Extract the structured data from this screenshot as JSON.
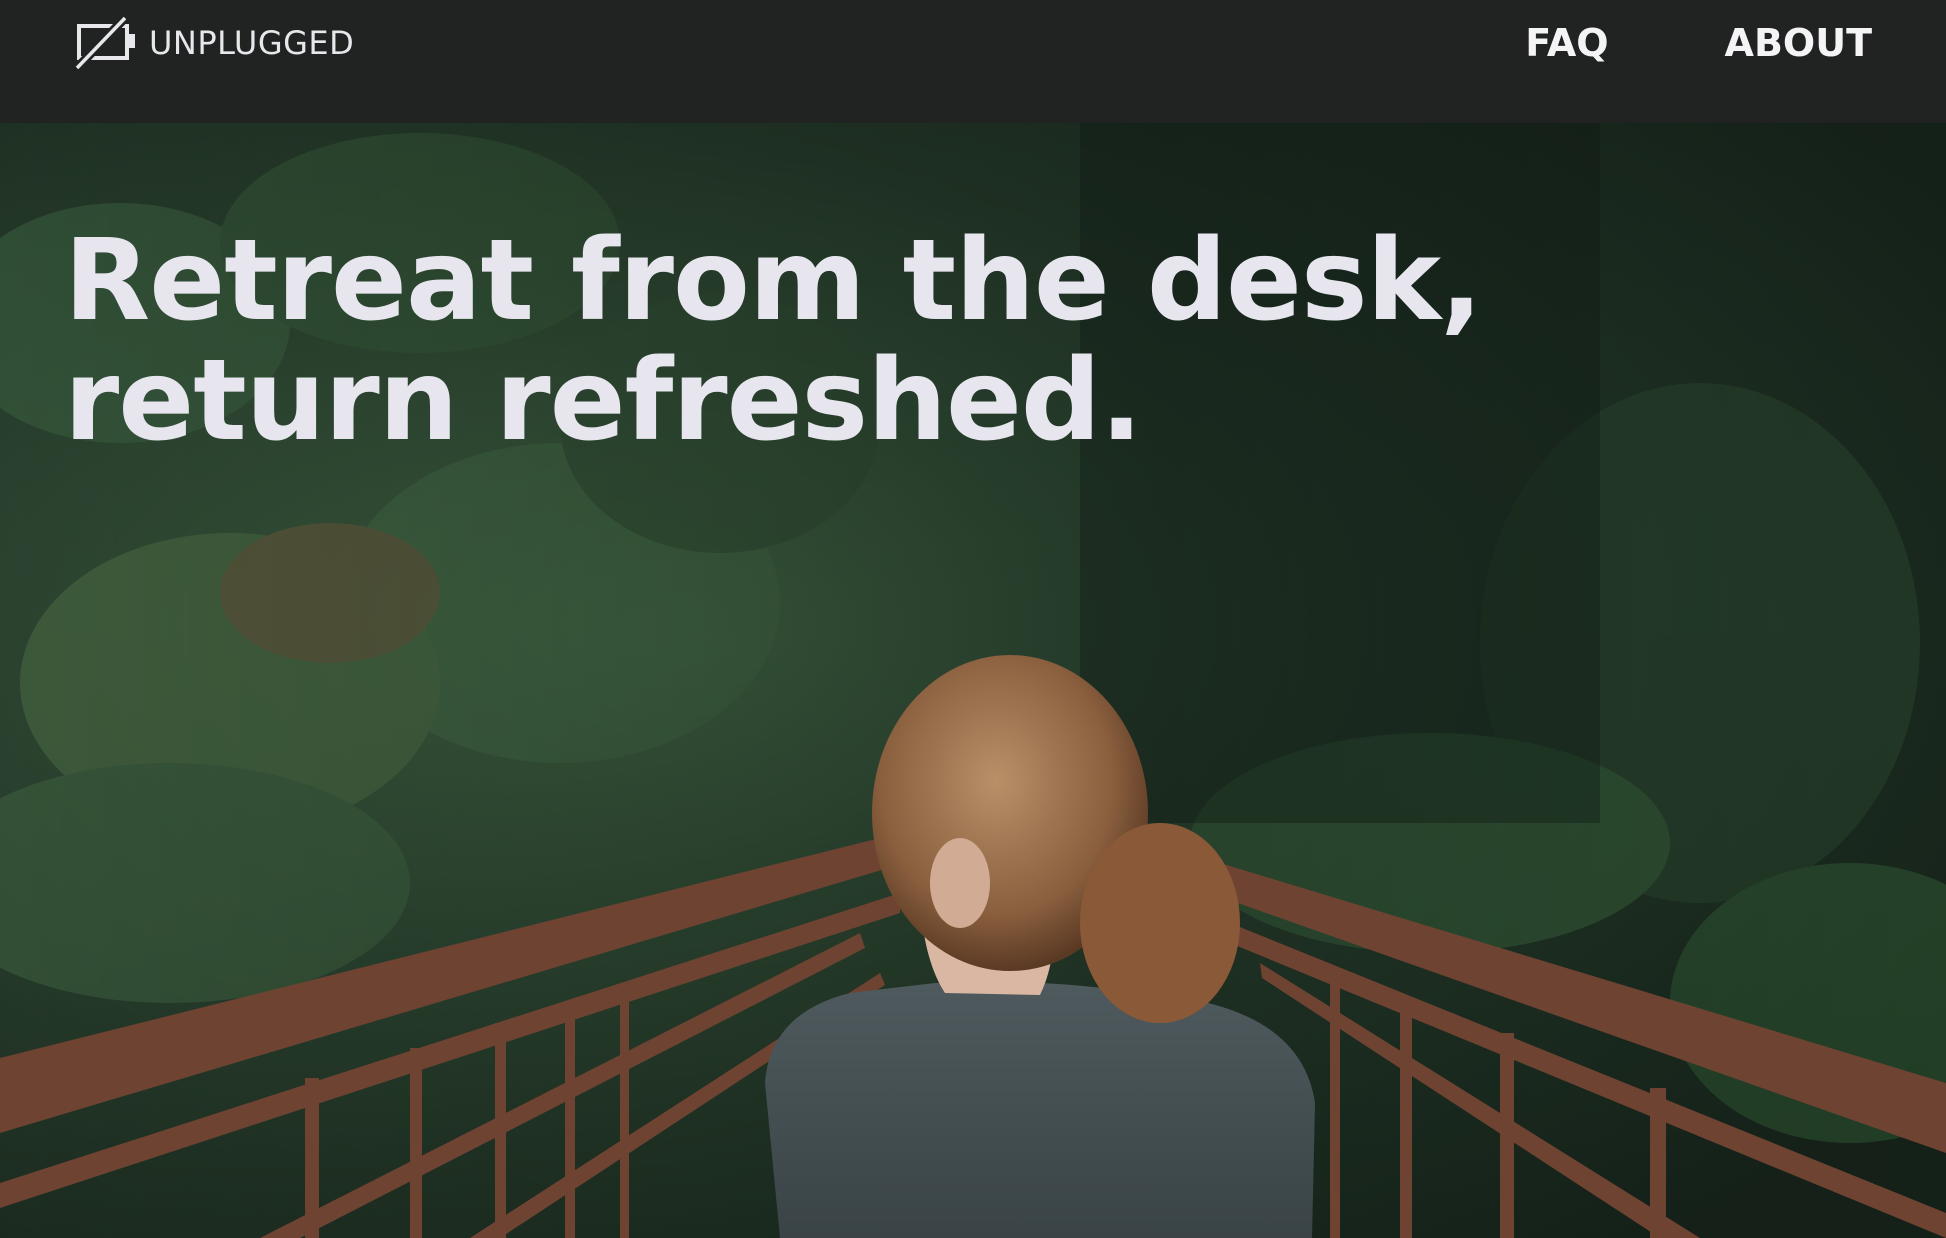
{
  "header": {
    "logo_text": "UNPLUGGED",
    "logo_icon": "unplugged-screen-icon",
    "nav": [
      {
        "label": "FAQ"
      },
      {
        "label": "ABOUT"
      }
    ]
  },
  "hero": {
    "headline_line1": "Retreat from the desk,",
    "headline_line2": "return refreshed.",
    "image_description_icon": "forest-bridge-photo"
  },
  "colors": {
    "navbar_bg": "#212222",
    "headline_text": "#e7e6ee",
    "nav_text": "#f4f4f6",
    "bridge_rust": "#7a4a38",
    "forest_dark": "#1c2b1f"
  }
}
